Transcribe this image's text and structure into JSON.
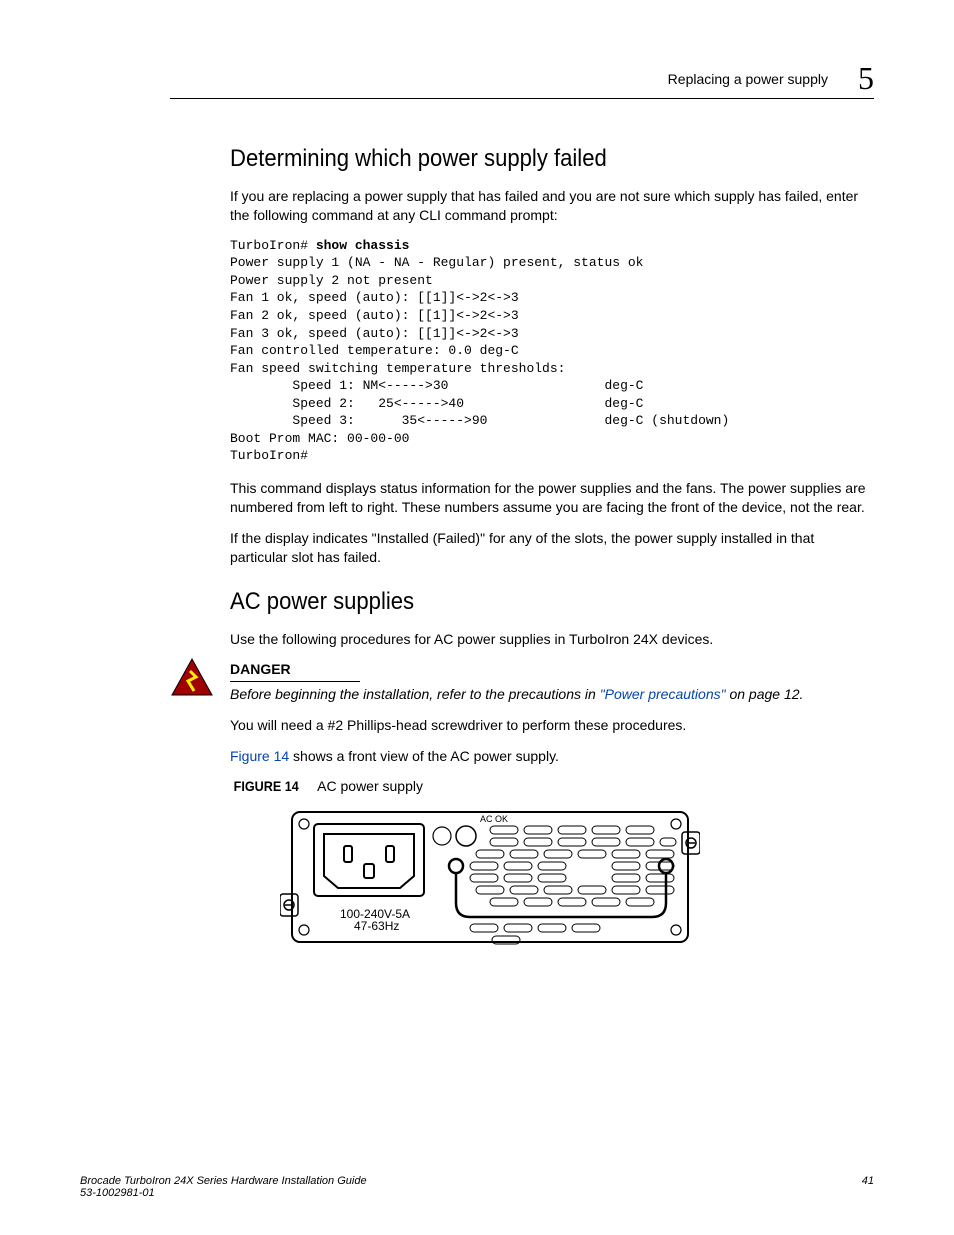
{
  "header": {
    "section": "Replacing a power supply",
    "chapter_number": "5"
  },
  "sections": {
    "s1_title": "Determining which power supply failed",
    "s1_p1": "If you are replacing a power supply that has failed and you are not sure which supply has failed, enter the following command at any CLI command prompt:",
    "cli_prefix": "TurboIron# ",
    "cli_cmd": "show chassis",
    "cli_output": "Power supply 1 (NA - NA - Regular) present, status ok\nPower supply 2 not present\nFan 1 ok, speed (auto): [[1]]<->2<->3\nFan 2 ok, speed (auto): [[1]]<->2<->3\nFan 3 ok, speed (auto): [[1]]<->2<->3\nFan controlled temperature: 0.0 deg-C\nFan speed switching temperature thresholds:\n        Speed 1: NM<----->30                    deg-C\n        Speed 2:   25<----->40                  deg-C\n        Speed 3:      35<----->90               deg-C (shutdown)\nBoot Prom MAC: 00-00-00\nTurboIron#",
    "s1_p2": "This command displays status information for the power supplies and the fans. The power supplies are numbered from left to right. These numbers assume you are facing the front of the device, not the rear.",
    "s1_p3": "If the display indicates \"Installed (Failed)\" for any of the slots, the power supply installed in that particular slot has failed.",
    "s2_title": "AC power supplies",
    "s2_p1": "Use the following procedures for AC power supplies in TurboIron 24X devices.",
    "danger_label": "DANGER",
    "danger_text_pre": "Before beginning the installation, refer to the precautions in ",
    "danger_link": "\"Power precautions\"",
    "danger_text_post": " on page 12.",
    "s2_p2": "You will need a #2 Phillips-head screwdriver to perform these procedures.",
    "s2_p3_link": "Figure 14",
    "s2_p3_rest": " shows a front view of the AC power supply.",
    "fig_label": "FIGURE 14",
    "fig_caption": "AC power supply",
    "psu_label_acok": "AC  OK",
    "psu_label_volt": "100-240V-5A",
    "psu_label_hz": "47-63Hz"
  },
  "footer": {
    "left1": "Brocade TurboIron 24X Series Hardware Installation Guide",
    "left2": "53-1002981-01",
    "right": "41"
  }
}
